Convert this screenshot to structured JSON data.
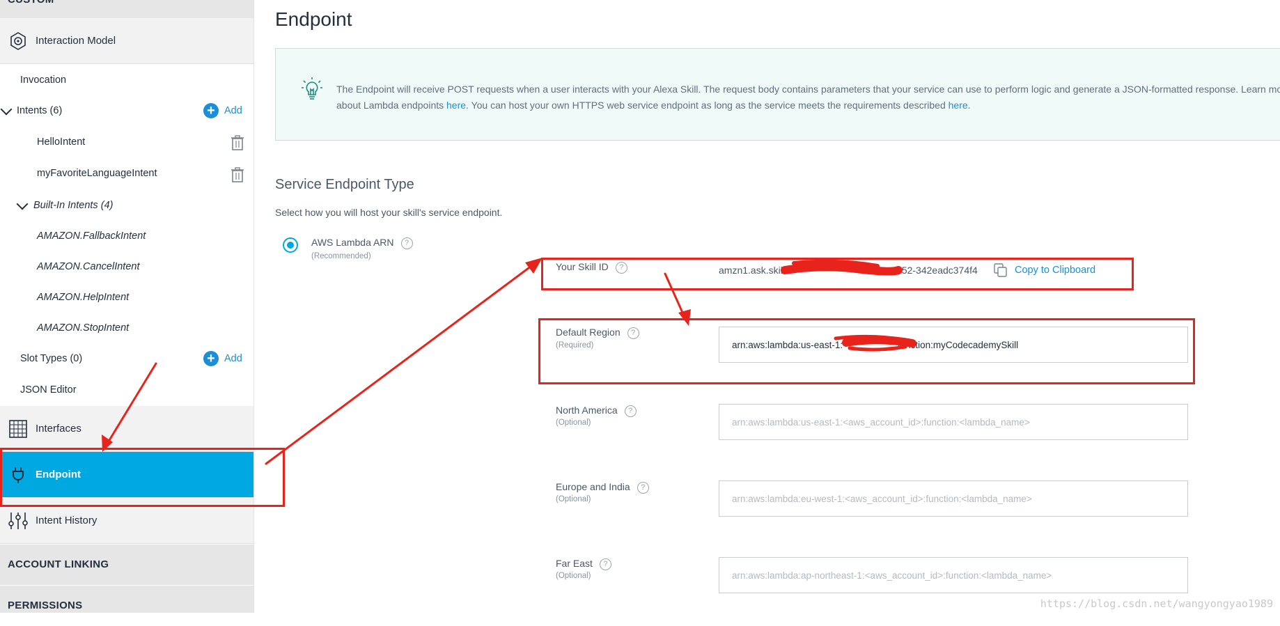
{
  "sidebar": {
    "top_header": "CUSTOM",
    "interaction_model": "Interaction Model",
    "invocation": "Invocation",
    "intents": "Intents (6)",
    "add_label": "Add",
    "intent_items": [
      "HelloIntent",
      "myFavoriteLanguageIntent"
    ],
    "built_in_intents": "Built-In Intents (4)",
    "built_in_items": [
      "AMAZON.FallbackIntent",
      "AMAZON.CancelIntent",
      "AMAZON.HelpIntent",
      "AMAZON.StopIntent"
    ],
    "slot_types": "Slot Types (0)",
    "json_editor": "JSON Editor",
    "interfaces": "Interfaces",
    "endpoint": "Endpoint",
    "intent_history": "Intent History",
    "account_linking": "ACCOUNT LINKING",
    "permissions": "PERMISSIONS"
  },
  "main": {
    "title": "Endpoint",
    "info": {
      "part1": "The Endpoint will receive POST requests when a user interacts with your Alexa Skill. The request body contains parameters that your service can use to perform logic and generate a JSON-formatted response. Learn more about Lambda endpoints ",
      "link1": "here",
      "part2": ". You can host your own HTTPS web service endpoint as long as the service meets the requirements described ",
      "link2": "here",
      "part3": "."
    },
    "service_type_title": "Service Endpoint Type",
    "service_type_desc": "Select how you will host your skill's service endpoint.",
    "option_label": "AWS Lambda ARN",
    "option_sub": "(Recommended)",
    "skill_id_label": "Your Skill ID",
    "skill_id_value": "amzn1.ask.skill.",
    "skill_id_suffix": "52-342eadc374f4",
    "copy_label": "Copy to Clipboard",
    "default_region_label": "Default Region",
    "default_region_sub": "(Required)",
    "default_region_value": "arn:aws:lambda:us-east-1:                    :function:myCodecademySkill",
    "north_america_label": "North America",
    "north_america_sub": "(Optional)",
    "north_america_placeholder": "arn:aws:lambda:us-east-1:<aws_account_id>:function:<lambda_name>",
    "europe_label": "Europe and India",
    "europe_sub": "(Optional)",
    "europe_placeholder": "arn:aws:lambda:eu-west-1:<aws_account_id>:function:<lambda_name>",
    "far_east_label": "Far East",
    "far_east_sub": "(Optional)",
    "far_east_placeholder": "arn:aws:lambda:ap-northeast-1:<aws_account_id>:function:<lambda_name>",
    "help_mark": "?"
  },
  "watermark": "https://blog.csdn.net/wangyongyao1989",
  "colors": {
    "accent": "#00a8e1",
    "link": "#1a8fd8",
    "annotation": "#e8231c"
  }
}
